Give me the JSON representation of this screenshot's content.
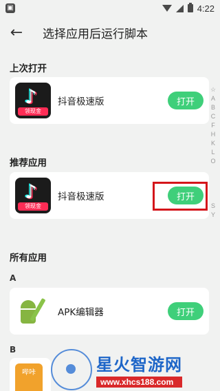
{
  "status_bar": {
    "time": "4:22"
  },
  "app_bar": {
    "title": "选择应用后运行脚本"
  },
  "sections": {
    "recent": {
      "title": "上次打开",
      "app_name": "抖音极速版",
      "open_label": "打开",
      "icon_badge": "领现金"
    },
    "recommended": {
      "title": "推荐应用",
      "app_name": "抖音极速版",
      "open_label": "打开",
      "icon_badge": "领现金"
    },
    "all": {
      "title": "所有应用",
      "groups": [
        {
          "letter": "A",
          "app_name": "APK编辑器",
          "open_label": "打开"
        },
        {
          "letter": "B",
          "partial_icon_text": "哔咔"
        }
      ]
    }
  },
  "alpha_index": [
    "☆",
    "A",
    "B",
    "C",
    "F",
    "H",
    "K",
    "L",
    "O",
    "",
    "",
    "",
    "",
    "S",
    "Y"
  ],
  "watermark": {
    "title": "星火智游网",
    "url": "www.xhcs188.com"
  },
  "colors": {
    "accent_green": "#3fcf7a",
    "highlight_red": "#d4151a",
    "background": "#f1f2f1"
  }
}
